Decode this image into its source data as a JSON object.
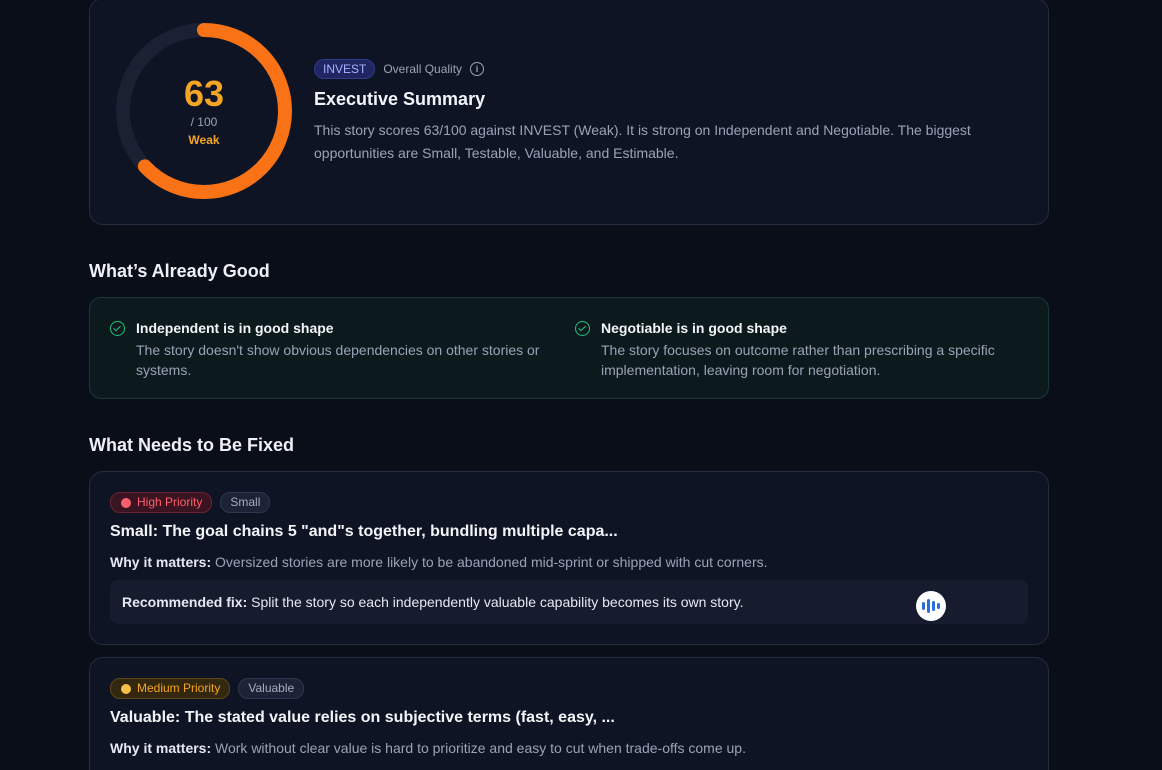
{
  "summary": {
    "score": "63",
    "score_value": 63,
    "score_max_label": "/ 100",
    "grade": "Weak",
    "badge": "INVEST",
    "overall_label": "Overall Quality",
    "info_glyph": "i",
    "title": "Executive Summary",
    "text": "This story scores 63/100 against INVEST (Weak). It is strong on Independent and Negotiable. The biggest opportunities are Small, Testable, Valuable, and Estimable.",
    "gauge_color": "#f97316",
    "track_color": "#1b2133"
  },
  "good_section": {
    "heading": "What’s Already Good",
    "items": [
      {
        "title": "Independent is in good shape",
        "description": "The story doesn't show obvious dependencies on other stories or systems."
      },
      {
        "title": "Negotiable is in good shape",
        "description": "The story focuses on outcome rather than prescribing a specific implementation, leaving room for negotiation."
      }
    ]
  },
  "fix_section": {
    "heading": "What Needs to Be Fixed",
    "why_label": "Why it matters:",
    "rec_label": "Recommended fix:",
    "items": [
      {
        "priority": "High Priority",
        "tag": "Small",
        "title": "Small: The goal chains 5 \"and\"s together, bundling multiple capa...",
        "why": "Oversized stories are more likely to be abandoned mid-sprint or shipped with cut corners.",
        "recommendation": "Split the story so each independently valuable capability becomes its own story."
      },
      {
        "priority": "Medium Priority",
        "tag": "Valuable",
        "title": "Valuable: The stated value relies on subjective terms (fast, easy, ...",
        "why": "Work without clear value is hard to prioritize and easy to cut when trade-offs come up."
      }
    ]
  },
  "colors": {
    "accent_orange": "#f5a524",
    "success_green": "#22c17a",
    "high_red": "#ff5f6d"
  },
  "icons": [
    "info-icon",
    "check-circle-icon",
    "priority-dot-icon",
    "voice-assistant-icon"
  ]
}
